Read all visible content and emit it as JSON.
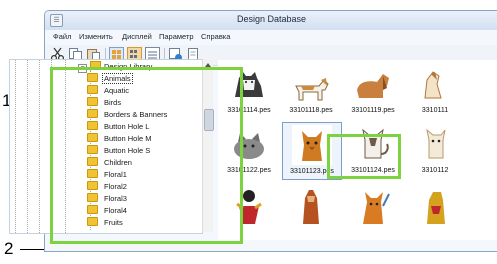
{
  "window": {
    "title": "Design Database"
  },
  "menu": [
    "Файл",
    "Изменить",
    "Дисплей",
    "Параметр",
    "Справка"
  ],
  "tree": {
    "root_label": "Design Library",
    "root_expander": "−",
    "items": [
      {
        "label": "Animals",
        "selected": true
      },
      {
        "label": "Aquatic"
      },
      {
        "label": "Birds"
      },
      {
        "label": "Borders & Banners"
      },
      {
        "label": "Button Hole L"
      },
      {
        "label": "Button Hole M"
      },
      {
        "label": "Button Hole S"
      },
      {
        "label": "Children"
      },
      {
        "label": "Floral1"
      },
      {
        "label": "Floral2"
      },
      {
        "label": "Floral3"
      },
      {
        "label": "Floral4"
      },
      {
        "label": "Fruits"
      }
    ]
  },
  "thumbnails": [
    {
      "caption": "33101114.pes",
      "icon": "husky-dog-icon",
      "color": "#3b3b3b"
    },
    {
      "caption": "33101118.pes",
      "icon": "beagle-dog-icon",
      "color": "#c98b3c"
    },
    {
      "caption": "33101119.pes",
      "icon": "spaniel-dog-icon",
      "color": "#c9803f"
    },
    {
      "caption": "3310111",
      "icon": "dog-icon",
      "color": "#b0763a"
    },
    {
      "caption": "33101122.pes",
      "icon": "grey-cat-icon",
      "color": "#8a8a8a"
    },
    {
      "caption": "33101123.pes",
      "icon": "orange-cat-icon",
      "color": "#d07a22",
      "selected": true
    },
    {
      "caption": "33101124.pes",
      "icon": "siamese-cat-icon",
      "color": "#6d5a4a"
    },
    {
      "caption": "3310112",
      "icon": "cat-icon",
      "color": "#b79a6b"
    },
    {
      "caption": "",
      "icon": "figure-icon",
      "color": "#c0272d"
    },
    {
      "caption": "",
      "icon": "animal-icon",
      "color": "#b5521f"
    },
    {
      "caption": "",
      "icon": "fox-icon",
      "color": "#d87b22"
    },
    {
      "caption": "",
      "icon": "animal-icon",
      "color": "#d4a21f"
    }
  ],
  "callouts": {
    "one": "1",
    "two": "2"
  },
  "colors": {
    "highlight": "#7dd33f",
    "folder": "#f1c232"
  }
}
